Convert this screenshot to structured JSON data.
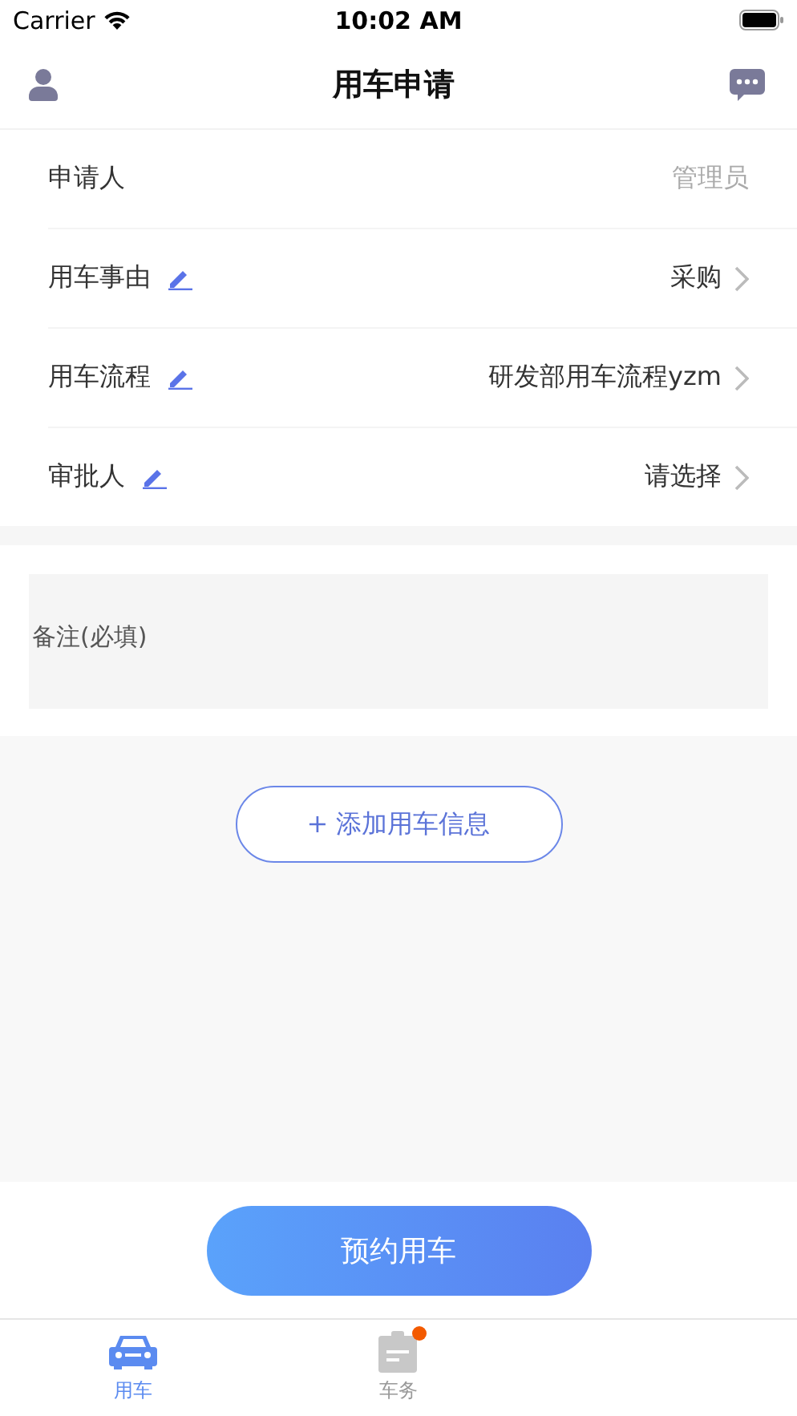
{
  "status_bar": {
    "carrier": "Carrier",
    "time": "10:02 AM"
  },
  "nav": {
    "title": "用车申请"
  },
  "form_rows": [
    {
      "label": "申请人",
      "value": "管理员",
      "kind": "static",
      "editable": false
    },
    {
      "label": "用车事由",
      "value": "采购",
      "kind": "picker",
      "editable": true
    },
    {
      "label": "用车流程",
      "value": "研发部用车流程yzm",
      "kind": "picker",
      "editable": true
    },
    {
      "label": "审批人",
      "value": "请选择",
      "kind": "picker",
      "editable": true
    }
  ],
  "remark": {
    "placeholder": "备注(必填)"
  },
  "add_button": "+ 添加用车信息",
  "submit_button": "预约用车",
  "tabs": [
    {
      "label": "用车",
      "selected": true,
      "kind": "car",
      "badge": false
    },
    {
      "label": "车务",
      "selected": false,
      "kind": "clipboard",
      "badge": true
    }
  ]
}
